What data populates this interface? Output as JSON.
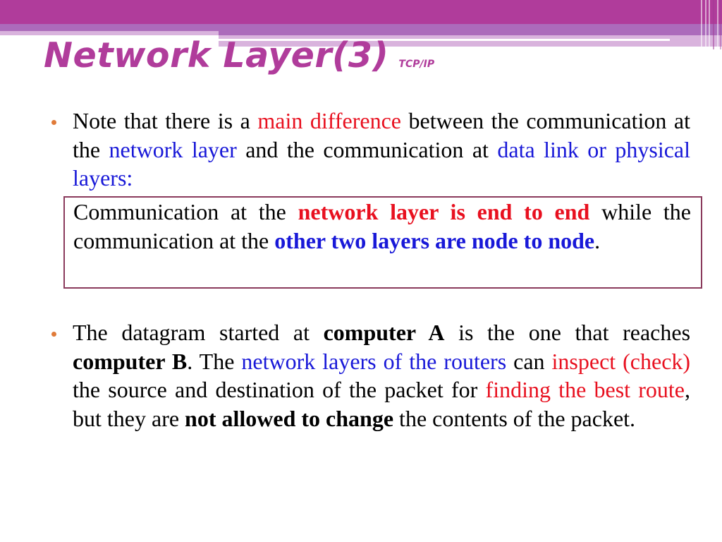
{
  "slide": {
    "title": "Network Layer(3)",
    "subtitle": "TCP/IP",
    "colors": {
      "accent": "#b03c9b",
      "band_mid": "#ac6bbb",
      "band_light": "#d9b3dd",
      "bullet": "#e07b39",
      "highlight_red": "#e8101f",
      "highlight_blue": "#1818d8",
      "box_border": "#8a3a5c"
    },
    "bullet1": {
      "t1": "Note that there is a ",
      "t2": "main difference",
      "t3": " between the communication at the ",
      "t4": "network layer",
      "t5": " and the communication at ",
      "t6": "data link or physical layers:"
    },
    "box": {
      "t1": "Communication at the ",
      "t2": "network layer is end to end",
      "t3": " while the communication at the ",
      "t4": "other two layers are node to node",
      "t5": "."
    },
    "bullet2": {
      "t1": "The datagram started at ",
      "t2": "computer A",
      "t3": " is the one that reaches ",
      "t4": "computer B",
      "t5": ". The ",
      "t6": "network layers of the routers",
      "t7": " can ",
      "t8": "inspect (check)",
      "t9": " the source and destination of the packet for ",
      "t10": "finding the best route",
      "t11": ", but they are ",
      "t12": "not allowed to change",
      "t13": " the contents of the packet."
    }
  }
}
